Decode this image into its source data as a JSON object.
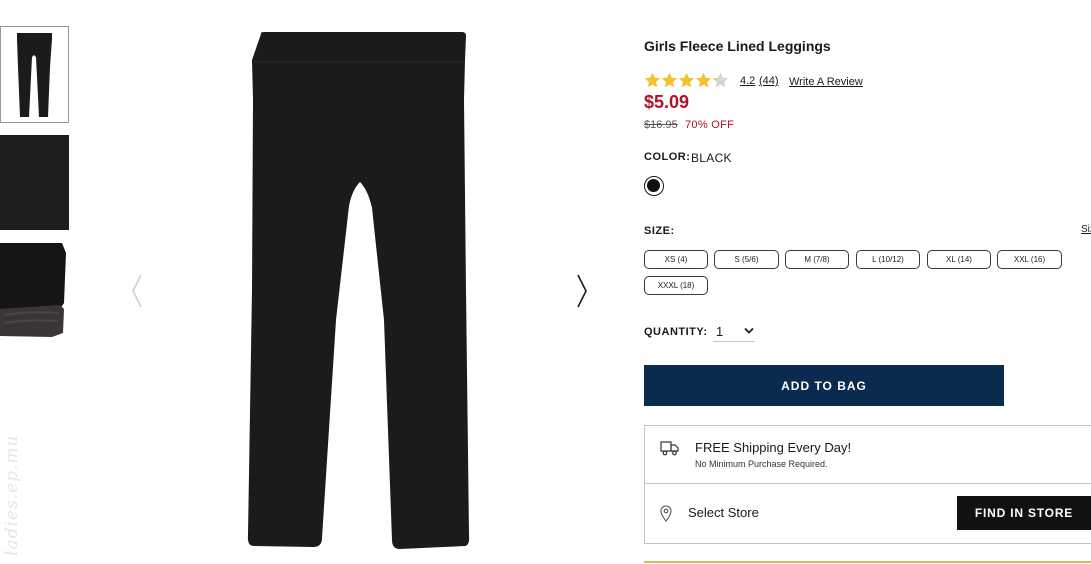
{
  "product": {
    "title": "Girls Fleece Lined Leggings",
    "rating": 4.2,
    "rating_display": "4.2",
    "review_count": "(44)",
    "write_review_label": "Write A Review",
    "price": "$5.09",
    "original_price": "$16.95",
    "discount": "70% OFF"
  },
  "color": {
    "label": "COLOR:",
    "value": "BLACK",
    "swatch_hex": "#111111"
  },
  "size": {
    "label": "SIZE:",
    "chart_link": "Size Chart",
    "options": [
      "XS (4)",
      "S (5/6)",
      "M (7/8)",
      "L (10/12)",
      "XL (14)",
      "XXL (16)",
      "XXXL (18)"
    ]
  },
  "quantity": {
    "label": "QUANTITY:",
    "value": "1"
  },
  "actions": {
    "add_to_bag": "ADD TO BAG",
    "find_in_store": "FIND IN STORE"
  },
  "shipping": {
    "title": "FREE Shipping Every Day!",
    "subtitle": "No Minimum Purchase Required.",
    "select_store": "Select Store"
  },
  "gallery": {
    "thumbnail_count": 3,
    "selected_index": 0,
    "watermark": "ladies.ep.mu"
  },
  "colors": {
    "price_red": "#b5102c",
    "bag_button_navy": "#0b2a4f",
    "star_gold": "#f2c230",
    "product_black": "#1b1a1c"
  },
  "icons": {
    "prev": "chevron-left-icon",
    "next": "chevron-right-icon",
    "shipping": "truck-icon",
    "store": "location-pin-icon",
    "quantity": "chevron-down-icon",
    "rating": "star-icon"
  }
}
